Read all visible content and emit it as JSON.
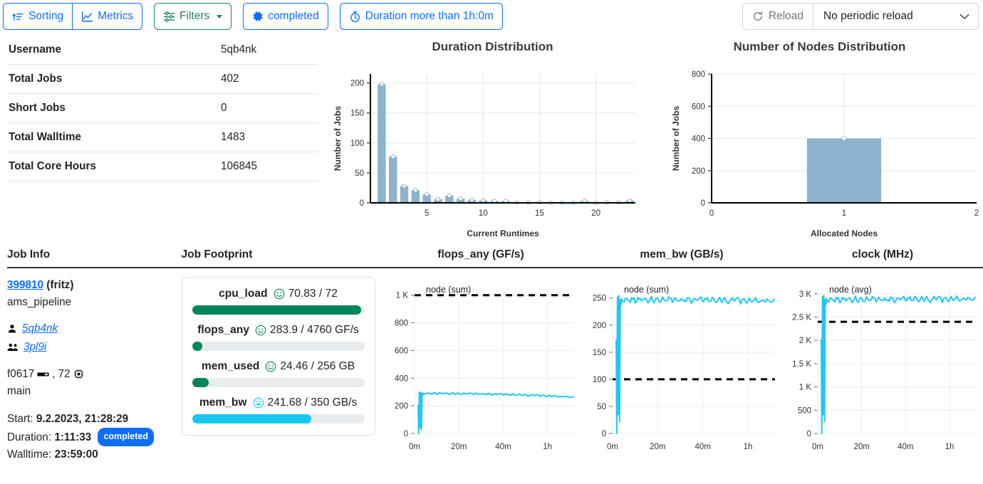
{
  "toolbar": {
    "sorting_label": "Sorting",
    "metrics_label": "Metrics",
    "filters_label": "Filters",
    "completed_label": "completed",
    "duration_filter_label": "Duration more than 1h:0m",
    "reload_label": "Reload",
    "periodic_reload_value": "No periodic reload",
    "accent_blue": "#0d6efd",
    "accent_green": "#198754"
  },
  "stats": {
    "rows": [
      {
        "key": "Username",
        "value": "5qb4nk"
      },
      {
        "key": "Total Jobs",
        "value": "402"
      },
      {
        "key": "Short Jobs",
        "value": "0"
      },
      {
        "key": "Total Walltime",
        "value": "1483"
      },
      {
        "key": "Total Core Hours",
        "value": "106845"
      }
    ]
  },
  "chart_data": [
    {
      "type": "bar",
      "title": "Duration Distribution",
      "xlabel": "Current Runtimes",
      "ylabel": "Number of Jobs",
      "xlim": [
        0,
        23.5
      ],
      "ylim": [
        0,
        215
      ],
      "xticks": [
        5,
        10,
        15,
        20
      ],
      "yticks": [
        0,
        50,
        100,
        150,
        200
      ],
      "grid": true,
      "categories": [
        1,
        2,
        3,
        4,
        5,
        6,
        7,
        8,
        9,
        10,
        11,
        12,
        13,
        14,
        15,
        16,
        17,
        18,
        19,
        20,
        21,
        22,
        23
      ],
      "values": [
        198,
        77,
        28,
        21,
        14,
        6,
        12,
        7,
        5,
        4,
        3,
        3,
        1,
        1,
        1,
        0,
        0,
        0,
        3,
        0,
        1,
        1,
        4
      ]
    },
    {
      "type": "bar",
      "title": "Number of Nodes Distribution",
      "xlabel": "Allocated Nodes",
      "ylabel": "Number of Jobs",
      "xlim": [
        0,
        2
      ],
      "ylim": [
        0,
        800
      ],
      "xticks": [
        0,
        1,
        2
      ],
      "yticks": [
        0,
        200,
        400,
        600,
        800
      ],
      "grid": true,
      "categories": [
        1
      ],
      "values": [
        400
      ]
    },
    {
      "type": "line",
      "title": "flops_any (GF/s)",
      "series_label": "node (sum)",
      "xlabel": "",
      "ylabel": "",
      "xticks": [
        "0m",
        "20m",
        "40m",
        "1h"
      ],
      "yticks": [
        "0",
        "200",
        "400",
        "600",
        "800",
        "1 K"
      ],
      "ylim": [
        0,
        1050
      ],
      "threshold": 1000,
      "grid": true,
      "plateau": 290,
      "end_value": 262
    },
    {
      "type": "line",
      "title": "mem_bw (GB/s)",
      "series_label": "node (sum)",
      "xlabel": "",
      "ylabel": "",
      "xticks": [
        "0m",
        "20m",
        "40m",
        "1h"
      ],
      "yticks": [
        "0",
        "50",
        "100",
        "150",
        "200",
        "250"
      ],
      "ylim": [
        0,
        268
      ],
      "threshold": 100,
      "grid": true,
      "plateau": 247,
      "end_value": 244
    },
    {
      "type": "line",
      "title": "clock (MHz)",
      "series_label": "node (avg)",
      "xlabel": "",
      "ylabel": "",
      "xticks": [
        "0m",
        "20m",
        "40m",
        "1h"
      ],
      "yticks": [
        "0",
        "500",
        "1 K",
        "1.5 K",
        "2 K",
        "2.5 K",
        "3 K"
      ],
      "ylim": [
        0,
        3120
      ],
      "threshold": 2400,
      "grid": true,
      "plateau": 2880,
      "end_value": 2885
    }
  ],
  "columns": {
    "job_info": "Job Info",
    "job_footprint": "Job Footprint",
    "flops_any": "flops_any (GF/s)",
    "mem_bw": "mem_bw (GB/s)",
    "clock": "clock (MHz)"
  },
  "job": {
    "id": "399810",
    "cluster": "(fritz)",
    "name": "ams_pipeline",
    "user": "5qb4nk",
    "project": "3pl9i",
    "node": "f0617",
    "cores": "72",
    "partition": "main",
    "start_label": "Start:",
    "start_value": "9.2.2023, 21:28:29",
    "duration_label": "Duration:",
    "duration_value": "1:11:33",
    "state_badge": "completed",
    "walltime_label": "Walltime:",
    "walltime_value": "23:59:00"
  },
  "footprint": {
    "items": [
      {
        "name": "cpu_load",
        "face": "☺",
        "value": "70.83 / 72",
        "pct": 98,
        "color": "#00865a",
        "face_color": "#00865a"
      },
      {
        "name": "flops_any",
        "face": "☺",
        "value": "283.9 / 4760 GF/s",
        "pct": 6,
        "color": "#00865a",
        "face_color": "#00865a"
      },
      {
        "name": "mem_used",
        "face": "☺",
        "value": "24.46 / 256 GB",
        "pct": 9.6,
        "color": "#00865a",
        "face_color": "#00865a"
      },
      {
        "name": "mem_bw",
        "face": "☺",
        "value": "241.68 / 350 GB/s",
        "pct": 69,
        "color": "#16c8f0",
        "face_color": "#16c8f0"
      }
    ]
  }
}
